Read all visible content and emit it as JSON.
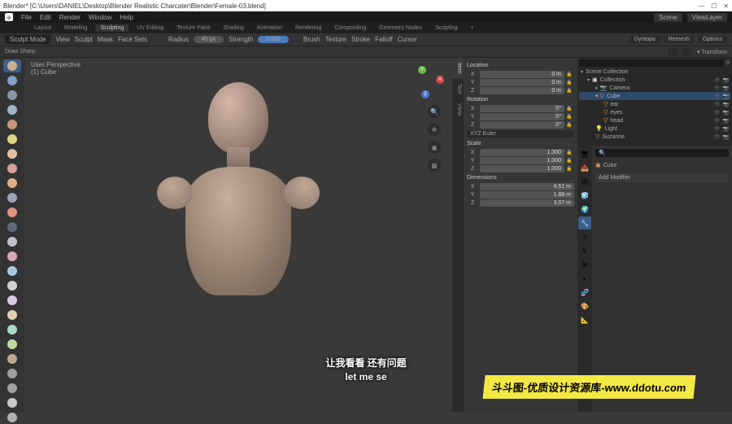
{
  "titlebar": {
    "text": "Blender* [C:\\Users\\DANIEL\\Desktop\\Blender Realistic Charcater\\Blender\\Female-03.blend]"
  },
  "menu": {
    "file": "File",
    "edit": "Edit",
    "render": "Render",
    "window": "Window",
    "help": "Help",
    "scene": "Scene",
    "viewlayer": "ViewLayer"
  },
  "workspaces": {
    "items": [
      "Layout",
      "Modeling",
      "Sculpting",
      "UV Editing",
      "Texture Paint",
      "Shading",
      "Animation",
      "Rendering",
      "Compositing",
      "Geometry Nodes",
      "Scripting",
      "+"
    ],
    "active": 2
  },
  "toolbar": {
    "mode": "Sculpt Mode",
    "view": "View",
    "sculpt": "Sculpt",
    "mask": "Mask",
    "face_sets": "Face Sets",
    "radius_l": "Radius",
    "radius_v": "45 px",
    "strength_l": "Strength",
    "strength_v": "0.500",
    "brush": "Brush",
    "texture": "Texture",
    "stroke": "Stroke",
    "falloff": "Falloff",
    "cursor": "Cursor",
    "dyntopo": "Dyntopo",
    "remesh": "Remesh",
    "options": "Options"
  },
  "header2": {
    "brush": "Draw Sharp",
    "transform": "Transform"
  },
  "vp": {
    "persp": "User Perspective",
    "obj": "(1) Cube"
  },
  "npanel": {
    "loc": "Location",
    "locX": "0 m",
    "locY": "0 m",
    "locZ": "0 m",
    "rot": "Rotation",
    "rotX": "0°",
    "rotY": "0°",
    "rotZ": "0°",
    "euler": "XYZ Euler",
    "scale": "Scale",
    "sX": "1.000",
    "sY": "1.000",
    "sZ": "1.000",
    "dim": "Dimensions",
    "dX": "4.51 m",
    "dY": "1.88 m",
    "dZ": "3.07 m",
    "tabs": {
      "item": "Item",
      "tool": "Tool",
      "view": "View"
    }
  },
  "outliner": {
    "scene": "Scene Collection",
    "coll": "Collection",
    "camera": "Camera",
    "cube": "Cube",
    "ear": "ear",
    "eyes": "eyes",
    "head": "head",
    "light": "Light",
    "suzanne": "Suzanne"
  },
  "props": {
    "cube": "Cube",
    "addmod": "Add Modifier"
  },
  "subs": {
    "cn": "让我看看 还有问题",
    "en": "let me se"
  },
  "watermark": "斗斗图-优质设计资源库-www.ddotu.com",
  "tool_colors": [
    "#c8b090",
    "#7fa0c4",
    "#8896a8",
    "#a0b4c8",
    "#c89878",
    "#e0d088",
    "#e0c0a0",
    "#d8a098",
    "#e0b088",
    "#a0a0b8",
    "#e09080",
    "#606878",
    "#c0c0c8",
    "#d8a8b8",
    "#a8c8e0",
    "#d0d0d0",
    "#d8c8e0",
    "#e0d0b0",
    "#a8d8c8",
    "#c0d8a0",
    "#c0a890",
    "#a0a0a0",
    "#a0a0a0",
    "#c8c8c8",
    "#b0b0b0"
  ]
}
